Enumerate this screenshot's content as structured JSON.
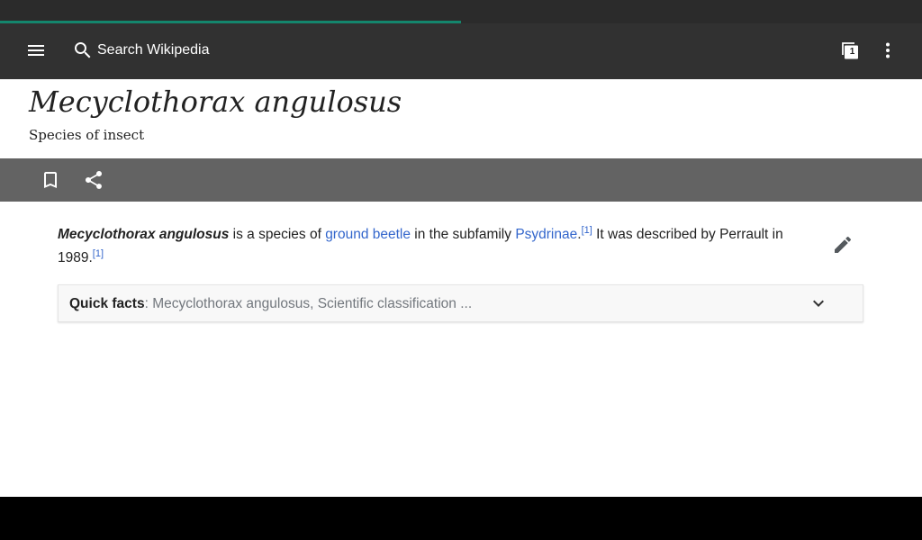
{
  "colors": {
    "accent": "#14866d",
    "toolbar": "#313131",
    "action_bar": "#636363",
    "link": "#3366cc"
  },
  "progress": {
    "fraction": 0.5
  },
  "toolbar": {
    "menu_icon": "menu-icon",
    "search_placeholder": "Search Wikipedia",
    "tabs_count": "1",
    "overflow_icon": "more-vert-icon"
  },
  "page": {
    "title": "Mecyclothorax angulosus",
    "description": "Species of insect"
  },
  "actions": {
    "bookmark_icon": "bookmark-icon",
    "share_icon": "share-icon"
  },
  "article": {
    "lead_bold": "Mecyclothorax angulosus",
    "text_1": " is a species of ",
    "link_1": "ground beetle",
    "text_2": " in the subfamily ",
    "link_2": "Psydrinae",
    "text_3": ".",
    "ref_1": "[1]",
    "text_4": " It was described by Perrault in 1989.",
    "ref_2": "[1]"
  },
  "quick_facts": {
    "label": "Quick facts",
    "separator": ": ",
    "summary": "Mecyclothorax angulosus, Scientific classification ..."
  }
}
